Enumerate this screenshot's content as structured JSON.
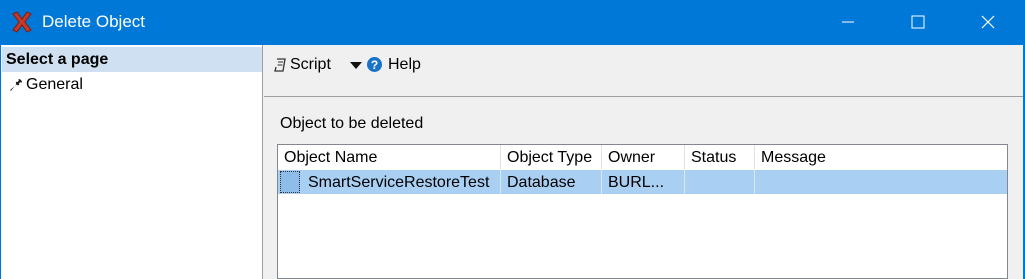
{
  "window": {
    "title": "Delete Object"
  },
  "sidebar": {
    "header": "Select a page",
    "items": [
      {
        "label": "General",
        "icon": "wrench-icon"
      }
    ]
  },
  "toolbar": {
    "script_label": "Script",
    "help_label": "Help"
  },
  "main": {
    "section_label": "Object to be deleted",
    "grid": {
      "columns": [
        "Object Name",
        "Object Type",
        "Owner",
        "Status",
        "Message"
      ],
      "rows": [
        {
          "object_name": "SmartServiceRestoreTest",
          "object_type": "Database",
          "owner": "BURL...",
          "status": "",
          "message": ""
        }
      ]
    }
  },
  "colors": {
    "titlebar": "#0078d7",
    "sidebar_header": "#cfe0f3",
    "selected_row": "#a9cff3",
    "help_icon": "#1a73c9",
    "app_icon": "#c0392b"
  }
}
